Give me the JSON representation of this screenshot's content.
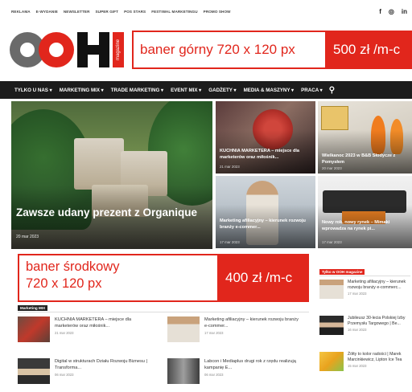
{
  "topbar": {
    "links": [
      "REKLAMA",
      "E-WYDANIE",
      "NEWSLETTER",
      "SUPER GIFT",
      "POS STARS",
      "FESTIWAL MARKETINGU",
      "PROMO SHOW"
    ],
    "social": [
      "f",
      "◎",
      "in"
    ]
  },
  "logo": {
    "text": "OOH",
    "sub": "magazine"
  },
  "top_banner": {
    "label": "baner górny 720 x 120 px",
    "price": "500 zł /m-c"
  },
  "nav": {
    "items": [
      "TYLKO U NAS ▾",
      "MARKETING MIX ▾",
      "TRADE MARKETING ▾",
      "EVENT MIX ▾",
      "GADŻETY ▾",
      "MEDIA & MASZYNY ▾",
      "PRACA ▾"
    ],
    "search_icon": "search-icon"
  },
  "hero": {
    "title": "Zawsze udany prezent z Organique",
    "date": "20 mar 2023"
  },
  "tiles": [
    {
      "title": "KUCHNIA MARKETERA – miejsce dla marketerów oraz miłośnik...",
      "date": "21 mar 2023"
    },
    {
      "title": "Wielkanoc 2023 w B&B Słodycze z Pomysłem",
      "date": "20 mar 2023"
    },
    {
      "title": "Marketing afiliacyjny – kierunek rozwoju branży e-commer...",
      "date": "17 mar 2023"
    },
    {
      "title": "Nowy rok, nowy rynek – Mimaki wprowadza na rynek pi...",
      "date": "17 mar 2023"
    }
  ],
  "mid_banner": {
    "line1": "baner środkowy",
    "line2": "720 x 120 px",
    "price": "400 zł /m-c"
  },
  "marketing_mix": {
    "label": "Marketing MIX",
    "articles": [
      {
        "title": "KUCHNIA MARKETERA – miejsce dla marketerów oraz miłośnik...",
        "date": "21 mar 2023"
      },
      {
        "title": "Marketing afiliacyjny – kierunek rozwoju branży e-commer...",
        "date": "17 mar 2023"
      },
      {
        "title": "Digital w strukturach Działu Rozwoju Biznesu | Transforma...",
        "date": "06 mar 2023"
      },
      {
        "title": "Labcon i Mediaplus drugi rok z rzędu realizują kampanię E...",
        "date": "06 mar 2023"
      }
    ]
  },
  "sidebar": {
    "label": "Tylko w OOH magazine",
    "items": [
      {
        "title": "Marketing afiliacyjny – kierunek rozwoju branży e-commerc...",
        "date": "17 mar 2023"
      },
      {
        "title": "Jubileusz 30-lecia Polskiej Izby Przemysłu Targowego | Be...",
        "date": "16 mar 2023"
      },
      {
        "title": "Żółty to kolor radości | Marek Marcinkiewicz, Lipton Ice Tea",
        "date": "15 mar 2023"
      }
    ]
  },
  "colors": {
    "accent": "#e1261c",
    "nav_bg": "#1c1c1c"
  }
}
